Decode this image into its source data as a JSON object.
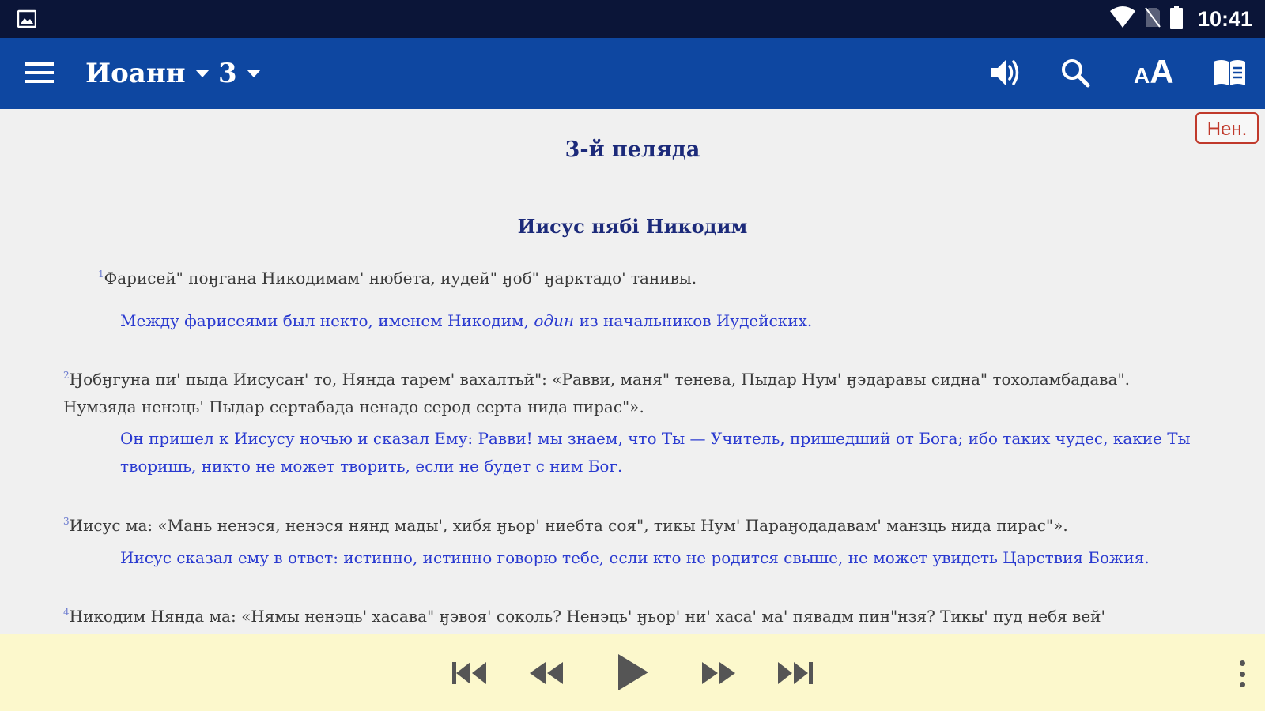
{
  "status_bar": {
    "time": "10:41",
    "icons": [
      "gallery-icon",
      "wifi-icon",
      "no-sim-icon",
      "battery-icon"
    ]
  },
  "toolbar": {
    "book": "Иоанн",
    "chapter": "3",
    "icons": [
      "menu-icon",
      "speaker-icon",
      "search-icon",
      "font-size-icon",
      "book-layout-icon"
    ],
    "font_small": "A",
    "font_big": "A"
  },
  "content": {
    "language_badge": "Нен.",
    "chapter_title": "3-й пелядa",
    "section_title": "Иисус нябi Никодим",
    "verses": [
      {
        "num": "1",
        "text": "Фарисей\" поӈгана Никодимам' нюбета, иудей\" ӈоб\" ӈарктадо' танивы.",
        "translation_pre": "Между фарисеями был некто, именем Никодим, ",
        "translation_em": "один",
        "translation_post": " из начальников Иудейских."
      },
      {
        "num": "2",
        "text": "Ӈобӈгуна пи' пыда Иисусан' то, Нянда тарем' вахалтьй\": «Равви, маня\" тенева, Пыдар Нум' ӈэдаравы сидна\" тохоламбадава\". Нумзяда ненэць' Пыдар сертабада ненадо серод серта нида пирас\"».",
        "translation": "Он пришел к Иисусу ночью и сказал Ему: Равви! мы знаем, что Ты — Учитель, пришедший от Бога; ибо таких чудес, какие Ты творишь, никто не может творить, если не будет с ним Бог."
      },
      {
        "num": "3",
        "text": "Иисус ма: «Мань ненэся, ненэся нянд мады', хибя ӈьор' ниебта соя\", тикы Нум' Параӈодадавам' манзць нида пирас\"».",
        "translation": "Иисус сказал ему в ответ: истинно, истинно говорю тебе, если кто не родится свыше, не может увидеть Царствия Божия."
      },
      {
        "num": "4",
        "text": "Никодим Нянда ма: «Нямы ненэць' хасава\" ӈэвоя' соколь? Ненэць' ӈьор' ни' хаса' ма' пявадм пин\"нзя? Тикы' пуд небя вей'"
      }
    ]
  },
  "player": {
    "icons": [
      "skip-previous-icon",
      "rewind-icon",
      "play-icon",
      "fast-forward-icon",
      "skip-next-icon",
      "more-vert-icon"
    ]
  }
}
